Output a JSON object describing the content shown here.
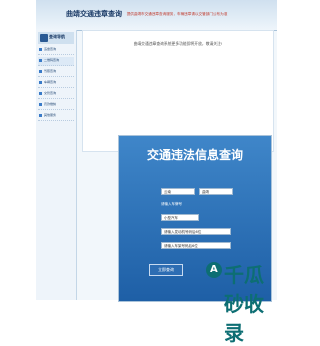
{
  "header": {
    "title": "曲靖交通违章查询"
  },
  "notice": "提供曲靖市交通违章查询服务，车辆违章请以交管部门公布为准",
  "sidebar": {
    "heading": "查询导航",
    "items": [
      {
        "label": "违章查询"
      },
      {
        "label": "二维码查询"
      },
      {
        "label": "驾照查询"
      },
      {
        "label": "车辆查询"
      },
      {
        "label": "交管查询"
      },
      {
        "label": "罚款缴纳"
      },
      {
        "label": "其他服务"
      }
    ]
  },
  "intro": {
    "text": "曲靖交通违章查询系统更多功能即将开放，敬请关注!"
  },
  "query": {
    "title": "交通违法信息查询",
    "province": "云南",
    "city": "曲靖",
    "plate_hint": "请输入车牌号",
    "type": "小型汽车",
    "plate_input": "",
    "engine_label": "请输入发动机号码后6位",
    "vin_label": "请输入车架号码后6位",
    "submit": "立即查询"
  },
  "watermark": {
    "text": "千瓜砂收录",
    "logo": "A"
  }
}
